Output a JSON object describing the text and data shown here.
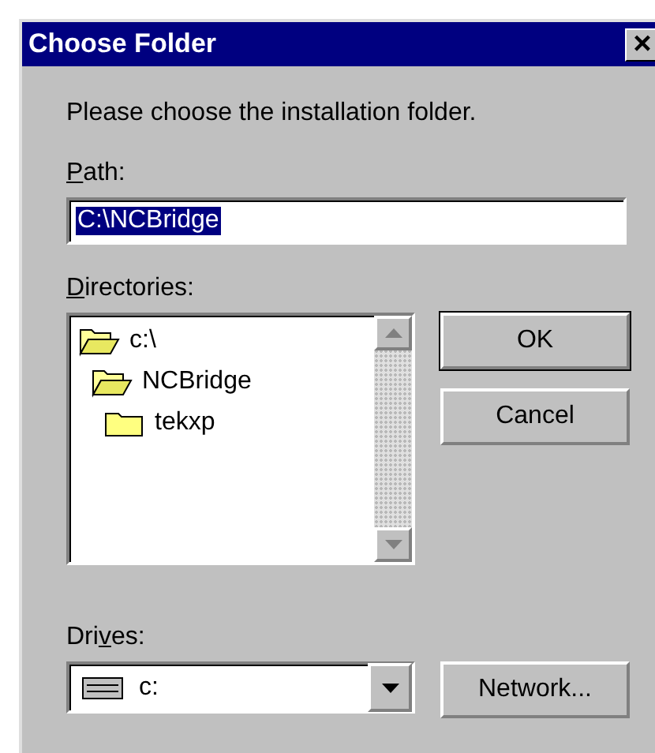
{
  "window": {
    "title": "Choose Folder",
    "close_glyph": "×"
  },
  "prompt": "Please choose the installation folder.",
  "path": {
    "label_parts": {
      "key": "P",
      "after": "ath:"
    },
    "value": "C:\\NCBridge",
    "selected": true
  },
  "directories": {
    "label_parts": {
      "key": "D",
      "after": "irectories:"
    },
    "items": [
      {
        "name": "c:\\",
        "expanded": true,
        "children": [
          {
            "name": "NCBridge",
            "expanded": true,
            "children": [
              {
                "name": "tekxp",
                "expanded": false
              }
            ]
          }
        ]
      }
    ]
  },
  "buttons": [
    {
      "label": "OK",
      "default": true
    },
    {
      "label": "Cancel",
      "default": false
    }
  ],
  "drives": {
    "label_parts": {
      "before": "Dri",
      "key": "v",
      "after": "es:"
    },
    "value": "c:"
  },
  "network_button": {
    "label": "Network..."
  }
}
